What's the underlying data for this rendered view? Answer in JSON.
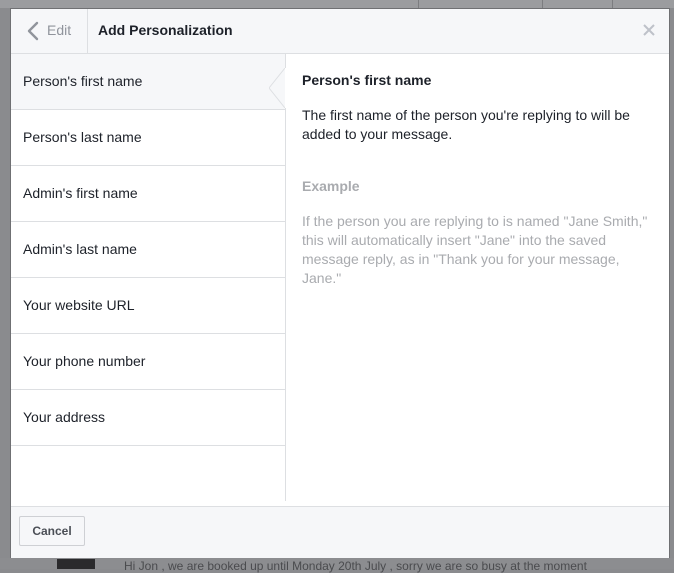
{
  "header": {
    "back_label": "Edit",
    "title": "Add Personalization",
    "back_icon": "chevron-left-icon",
    "close_icon": "close-icon"
  },
  "list": {
    "items": [
      {
        "label": "Person's first name",
        "selected": true
      },
      {
        "label": "Person's last name",
        "selected": false
      },
      {
        "label": "Admin's first name",
        "selected": false
      },
      {
        "label": "Admin's last name",
        "selected": false
      },
      {
        "label": "Your website URL",
        "selected": false
      },
      {
        "label": "Your phone number",
        "selected": false
      },
      {
        "label": "Your address",
        "selected": false
      }
    ]
  },
  "detail": {
    "title": "Person's first name",
    "description": "The first name of the person you're replying to will be added to your message.",
    "example_title": "Example",
    "example_text": "If the person you are replying to is named \"Jane Smith,\" this will automatically insert \"Jane\" into the saved message reply, as in \"Thank you for your message, Jane.\""
  },
  "footer": {
    "cancel_label": "Cancel"
  },
  "background": {
    "message_snippet": "Hi Jon , we are booked up until Monday 20th July , sorry we are so busy at the moment"
  },
  "colors": {
    "header_bg": "#f6f7f9",
    "border": "#dddfe2",
    "text": "#1d2129",
    "muted_text": "#a9abaf"
  }
}
